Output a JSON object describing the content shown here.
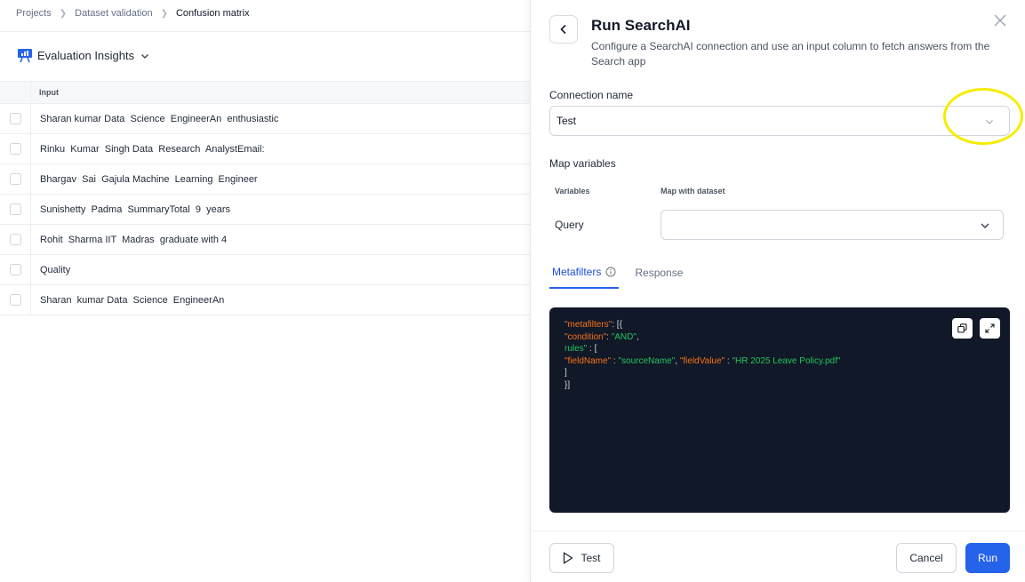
{
  "breadcrumb": {
    "items": [
      "Projects",
      "Dataset validation"
    ],
    "current": "Confusion matrix"
  },
  "insights": {
    "label": "Evaluation Insights",
    "icon": "presentation-chart-icon"
  },
  "table": {
    "header": "Input",
    "rows": [
      "Sharan kumar Data  Science  EngineerAn  enthusiastic",
      "Rinku  Kumar  Singh Data  Research  AnalystEmail:",
      "Bhargav  Sai  Gajula Machine  Learning  Engineer",
      "Sunishetty  Padma  SummaryTotal  9  years",
      "Rohit  Sharma IIT  Madras  graduate with 4",
      "Quality",
      "Sharan  kumar Data  Science  EngineerAn"
    ]
  },
  "panel": {
    "title": "Run SearchAI",
    "subtitle": "Configure a SearchAI connection and use an input column to fetch answers from the Search app",
    "connection": {
      "label": "Connection name",
      "value": "Test"
    },
    "map": {
      "label": "Map variables",
      "col_variables": "Variables",
      "col_dataset": "Map with dataset",
      "query_label": "Query",
      "query_value": ""
    },
    "tabs": [
      {
        "label": "Metafilters",
        "active": true
      },
      {
        "label": "Response",
        "active": false
      }
    ],
    "code": {
      "k1": "\"metafilters\"",
      "p1": ": [{",
      "k2": "\"condition\"",
      "p2": ": ",
      "s2": "\"AND\"",
      "p2b": ",",
      "s3": "rules\"",
      "p3": " : [",
      "k4a": "\"fieldName\"",
      "p4a": " : ",
      "s4a": "\"sourceName\"",
      "p4b": ", ",
      "k4b": "\"fieldValue\"",
      "p4c": " : ",
      "s4b": "\"HR 2025 Leave Policy.pdf\"",
      "l5": "]",
      "l6": "}]"
    },
    "buttons": {
      "test": "Test",
      "cancel": "Cancel",
      "run": "Run"
    }
  },
  "colors": {
    "accent": "#2563eb",
    "code_bg": "#111827",
    "highlight": "#f5ec00"
  }
}
